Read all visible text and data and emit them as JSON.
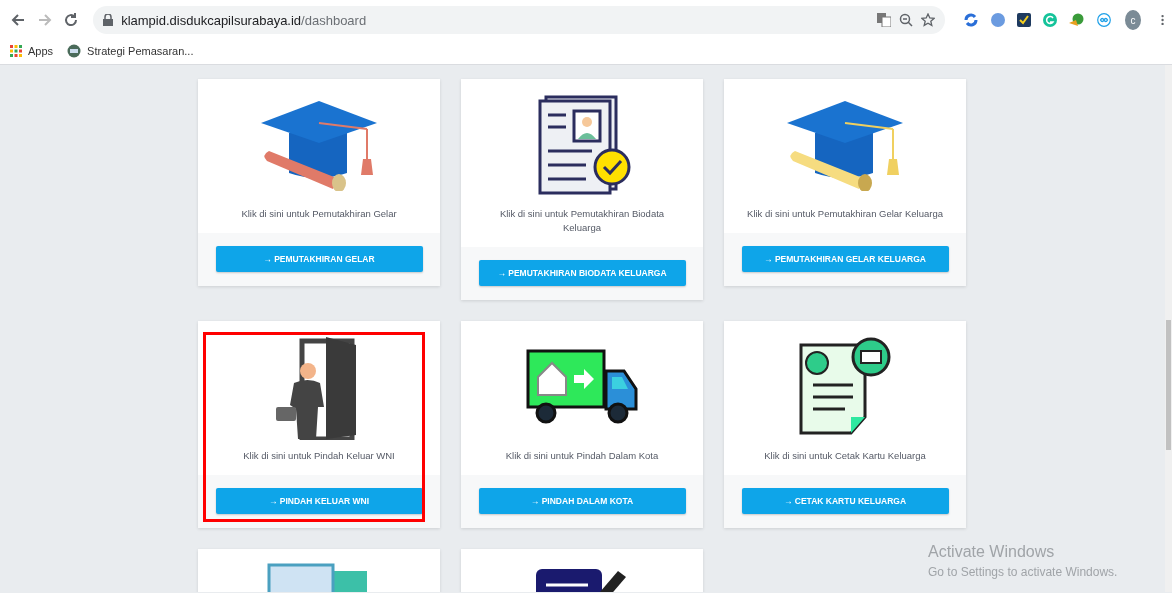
{
  "browser": {
    "url_host": "klampid.disdukcapilsurabaya.id",
    "url_path": "/dashboard",
    "profile_initial": "c",
    "bookmarks": [
      {
        "label": "Apps",
        "kind": "apps"
      },
      {
        "label": "Strategi Pemasaran...",
        "kind": "site"
      }
    ]
  },
  "cards": [
    {
      "kind": "cap-red",
      "caption": "Klik di sini untuk Pemutakhiran Gelar",
      "button": "→ PEMUTAKHIRAN GELAR",
      "highlighted": false
    },
    {
      "kind": "document",
      "caption": "Klik di sini untuk Pemutakhiran Biodata Keluarga",
      "button": "→ PEMUTAKHIRAN BIODATA KELUARGA",
      "highlighted": false
    },
    {
      "kind": "cap-yellow",
      "caption": "Klik di sini untuk Pemutakhiran Gelar Keluarga",
      "button": "→ PEMUTAKHIRAN GELAR KELUARGA",
      "highlighted": false
    },
    {
      "kind": "door",
      "caption": "Klik di sini untuk Pindah Keluar WNI",
      "button": "→ PINDAH KELUAR WNI",
      "highlighted": true
    },
    {
      "kind": "truck",
      "caption": "Klik di sini untuk Pindah Dalam Kota",
      "button": "→ PINDAH DALAM KOTA",
      "highlighted": false
    },
    {
      "kind": "family-card",
      "caption": "Klik di sini untuk Cetak Kartu Keluarga",
      "button": "→ CETAK KARTU KELUARGA",
      "highlighted": false
    },
    {
      "kind": "certificate"
    },
    {
      "kind": "form"
    }
  ],
  "os_notice": {
    "title": "Activate Windows",
    "subtitle": "Go to Settings to activate Windows."
  }
}
